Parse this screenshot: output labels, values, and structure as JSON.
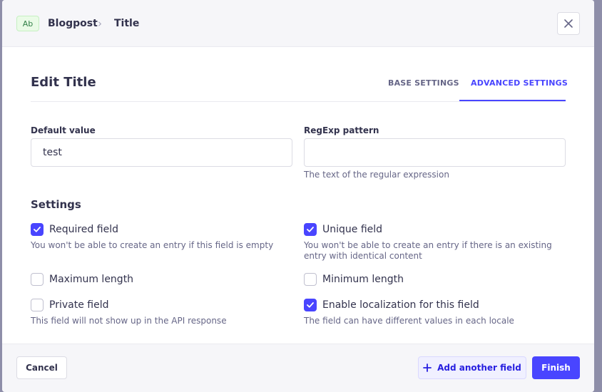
{
  "header": {
    "type_badge": "Ab",
    "breadcrumb": [
      "Blogpost",
      "Title"
    ],
    "separator": "›"
  },
  "main": {
    "title": "Edit Title",
    "tabs": [
      {
        "label": "BASE SETTINGS",
        "active": false
      },
      {
        "label": "ADVANCED SETTINGS",
        "active": true
      }
    ],
    "default_value": {
      "label": "Default value",
      "value": "test"
    },
    "regexp": {
      "label": "RegExp pattern",
      "value": "",
      "hint": "The text of the regular expression"
    },
    "settings_title": "Settings",
    "settings": {
      "required": {
        "label": "Required field",
        "checked": true,
        "hint": "You won't be able to create an entry if this field is empty"
      },
      "unique": {
        "label": "Unique field",
        "checked": true,
        "hint": "You won't be able to create an entry if there is an existing entry with identical content"
      },
      "maximum": {
        "label": "Maximum length",
        "checked": false
      },
      "minimum": {
        "label": "Minimum length",
        "checked": false
      },
      "private": {
        "label": "Private field",
        "checked": false,
        "hint": "This field will not show up in the API response"
      },
      "localization": {
        "label": "Enable localization for this field",
        "checked": true,
        "hint": "The field can have different values in each locale"
      }
    }
  },
  "footer": {
    "cancel": "Cancel",
    "add_another": "Add another field",
    "finish": "Finish"
  },
  "colors": {
    "primary": "#4945ff",
    "text": "#32324d",
    "muted": "#666687",
    "badge_bg": "#eafbe7",
    "badge_text": "#328048"
  },
  "icons": [
    "close-icon",
    "chevron-right-icon",
    "check-icon",
    "plus-icon"
  ]
}
